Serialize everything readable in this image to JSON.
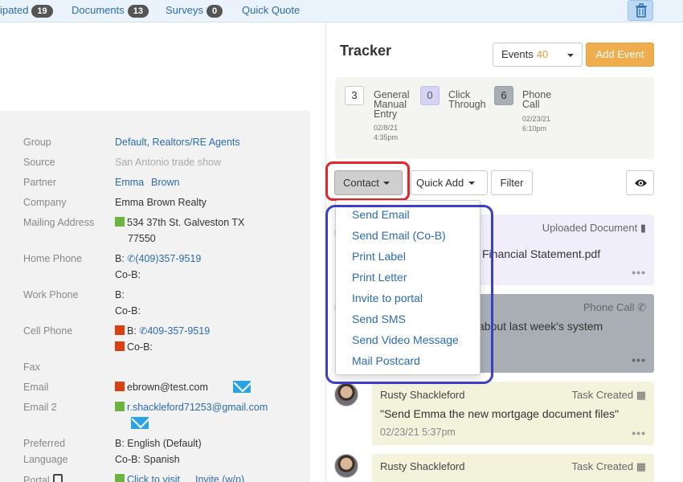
{
  "topnav": {
    "tabs": [
      {
        "label": "ipated",
        "count": "19"
      },
      {
        "label": "Documents",
        "count": "13"
      },
      {
        "label": "Surveys",
        "count": "0"
      },
      {
        "label": "Quick Quote"
      }
    ]
  },
  "contact_info": {
    "group": {
      "label": "Group",
      "value": "Default, Realtors/RE Agents"
    },
    "source": {
      "label": "Source",
      "value": "San Antonio trade show"
    },
    "partner": {
      "label": "Partner",
      "first": "Emma",
      "last": "Brown"
    },
    "company": {
      "label": "Company",
      "value": "Emma Brown Realty"
    },
    "mailing": {
      "label": "Mailing Address",
      "line1": "534 37th St. Galveston TX",
      "line2": "77550"
    },
    "home_phone": {
      "label": "Home Phone",
      "b_prefix": "B:",
      "b_value": "(409)357-9519",
      "cob": "Co-B:"
    },
    "work_phone": {
      "label": "Work Phone",
      "b_prefix": "B:",
      "cob": "Co-B:"
    },
    "cell_phone": {
      "label": "Cell Phone",
      "b_prefix": "B:",
      "b_value": "409-357-9519",
      "cob": "Co-B:"
    },
    "fax": {
      "label": "Fax"
    },
    "email": {
      "label": "Email",
      "value": "ebrown@test.com"
    },
    "email2": {
      "label": "Email 2",
      "value": "r.shackleford71253@gmail.com"
    },
    "preferred_language": {
      "label_line1": "Preferred",
      "label_line2": "Language",
      "b": "B: English (Default)",
      "cob": "Co-B: Spanish"
    },
    "portal": {
      "label": "Portal",
      "click_to_visit": "Click to visit",
      "invite": "Invite (w/p)"
    }
  },
  "tracker": {
    "title": "Tracker",
    "events_label": "Events",
    "events_count": "40",
    "add_event": "Add Event",
    "summary": [
      {
        "count": "3",
        "line1": "General",
        "line2": "Manual",
        "line3": "Entry",
        "date": "02/8/21",
        "time": "4:35pm"
      },
      {
        "count": "0",
        "line1": "Click",
        "line2": "Through"
      },
      {
        "count": "6",
        "line1": "Phone",
        "line2": "Call",
        "date": "02/23/21",
        "time": "6:10pm"
      }
    ],
    "buttons": {
      "contact": "Contact",
      "quick_add": "Quick Add",
      "filter": "Filter"
    }
  },
  "dropdown": {
    "items": [
      "Send Email",
      "Send Email (Co-B)",
      "Print Label",
      "Print Letter",
      "Invite to portal",
      "Send SMS",
      "Send Video Message",
      "Mail Postcard"
    ]
  },
  "timeline": [
    {
      "type": "Uploaded Document",
      "body": "Financial Statement.pdf",
      "color": "#f1eefb"
    },
    {
      "type": "Phone Call",
      "body": "about last week's system",
      "color": "#a9aeb5"
    },
    {
      "author": "Rusty Shackleford",
      "type": "Task Created",
      "body": "\"Send Emma the new mortgage document files\"",
      "time": "02/23/21 5:37pm",
      "color": "#f3f3dc"
    },
    {
      "author": "Rusty Shackleford",
      "type": "Task Created",
      "color": "#f3f3dc"
    }
  ],
  "colors": {
    "accent": "#2b6cb0",
    "add_event": "#f0ad4e",
    "red_outline": "#e3242b",
    "blue_outline": "#3b3ec8"
  }
}
